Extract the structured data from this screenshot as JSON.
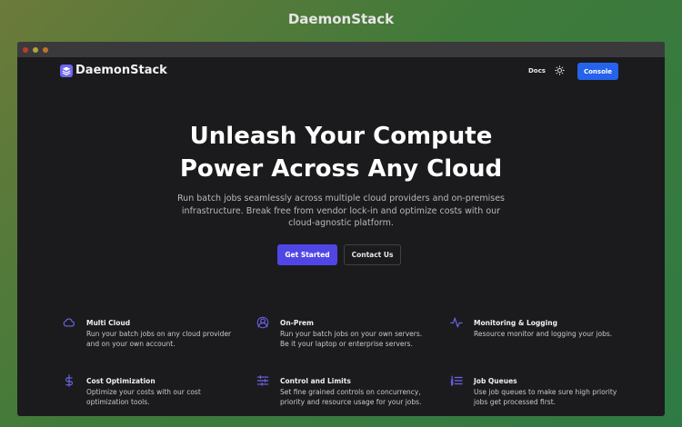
{
  "frame": {
    "title": "DaemonStack"
  },
  "nav": {
    "brand": "DaemonStack",
    "docs_label": "Docs",
    "console_label": "Console"
  },
  "hero": {
    "title_line1": "Unleash Your Compute",
    "title_line2": "Power Across Any Cloud",
    "subtitle": "Run batch jobs seamlessly across multiple cloud providers and on-premises infrastructure. Break free from vendor lock-in and optimize costs with our cloud-agnostic platform.",
    "primary_cta": "Get Started",
    "secondary_cta": "Contact Us"
  },
  "features": [
    {
      "icon": "cloud-icon",
      "title": "Multi Cloud",
      "description": "Run your batch jobs on any cloud provider and on your own account."
    },
    {
      "icon": "user-icon",
      "title": "On-Prem",
      "description": "Run your batch jobs on your own servers. Be it your laptop or enterprise servers."
    },
    {
      "icon": "activity-icon",
      "title": "Monitoring & Logging",
      "description": "Resource monitor and logging your jobs."
    },
    {
      "icon": "dollar-icon",
      "title": "Cost Optimization",
      "description": "Optimize your costs with our cost optimization tools."
    },
    {
      "icon": "sliders-icon",
      "title": "Control and Limits",
      "description": "Set fine grained controls on concurrency, priority and resource usage for your jobs."
    },
    {
      "icon": "list-ordered-icon",
      "title": "Job Queues",
      "description": "Use job queues to make sure high priority jobs get processed first."
    }
  ],
  "colors": {
    "accent": "#4f46e5",
    "console_button": "#2563eb",
    "icon": "#6d66f0",
    "background": "#1b1b1d"
  }
}
